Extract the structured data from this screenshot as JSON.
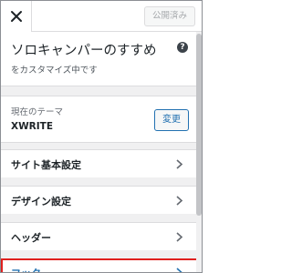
{
  "topbar": {
    "close_icon": "close-icon",
    "publish_label": "公開済み"
  },
  "header": {
    "site_title": "ソロキャンパーのすすめ",
    "subtitle": "をカスタマイズ中です",
    "help_icon": "help-icon",
    "help_glyph": "?"
  },
  "theme": {
    "label": "現在のテーマ",
    "name": "XWRITE",
    "change_label": "変更"
  },
  "menu": {
    "items": [
      {
        "label": "サイト基本設定",
        "icon": "chevron-right-icon"
      },
      {
        "label": "デザイン設定",
        "icon": "chevron-right-icon"
      },
      {
        "label": "ヘッダー",
        "icon": "chevron-right-icon"
      },
      {
        "label": "フッター",
        "icon": "chevron-right-icon",
        "highlighted": true
      }
    ]
  },
  "colors": {
    "accent": "#2271b1",
    "highlight_border": "#e0201e",
    "panel_bg": "#f0f0f1"
  }
}
